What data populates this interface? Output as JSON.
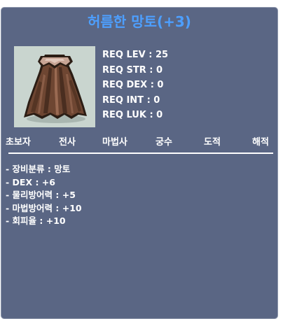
{
  "item": {
    "name": "허름한 망토(+3)",
    "icon": "brown-cape-icon"
  },
  "requirements": [
    "REQ LEV : 25",
    "REQ STR : 0",
    "REQ DEX : 0",
    "REQ INT : 0",
    "REQ LUK : 0"
  ],
  "jobs": [
    "초보자",
    "전사",
    "마법사",
    "궁수",
    "도적",
    "해적"
  ],
  "stats": [
    "- 장비분류 : 망토",
    "- DEX : +6",
    "- 물리방어력 : +5",
    "- 마법방어력 : +10",
    "- 회피율 : +10"
  ],
  "colors": {
    "panel": "#5a6684",
    "title": "#4d9fff",
    "text": "#ffffff"
  }
}
